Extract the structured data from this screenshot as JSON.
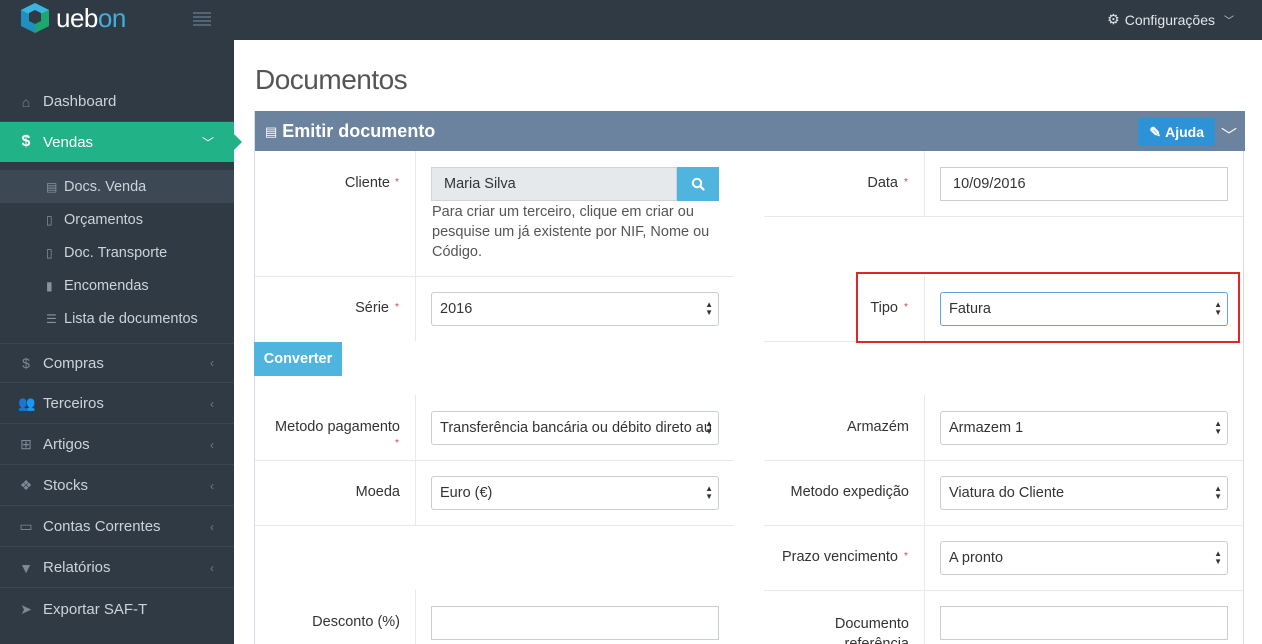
{
  "brand": {
    "name_prefix": "ueb",
    "name_suffix": "on"
  },
  "topbar": {
    "config_label": "Configurações"
  },
  "sidebar": {
    "items": [
      {
        "label": "Dashboard",
        "icon": "home-icon"
      },
      {
        "label": "Vendas",
        "icon": "dollar-icon",
        "active": true
      },
      {
        "label": "Compras",
        "icon": "dollar-icon"
      },
      {
        "label": "Terceiros",
        "icon": "users-icon"
      },
      {
        "label": "Artigos",
        "icon": "sitemap-icon"
      },
      {
        "label": "Stocks",
        "icon": "cubes-icon"
      },
      {
        "label": "Contas Correntes",
        "icon": "credit-card-icon"
      },
      {
        "label": "Relatórios",
        "icon": "filter-icon"
      },
      {
        "label": "Exportar SAF-T",
        "icon": "paper-plane-icon"
      }
    ],
    "submenu": [
      {
        "label": "Docs. Venda",
        "icon": "document-icon"
      },
      {
        "label": "Orçamentos",
        "icon": "file-icon"
      },
      {
        "label": "Doc. Transporte",
        "icon": "file-icon"
      },
      {
        "label": "Encomendas",
        "icon": "file-filled-icon"
      },
      {
        "label": "Lista de documentos",
        "icon": "list-icon"
      }
    ]
  },
  "page": {
    "title": "Documentos"
  },
  "panel": {
    "title": "Emitir documento",
    "help_label": "Ajuda"
  },
  "form": {
    "cliente": {
      "label": "Cliente",
      "value": "Maria Silva",
      "help": [
        "Para criar um terceiro, clique em criar ou",
        "pesquise um já existente por NIF, Nome ou",
        "Código."
      ]
    },
    "data": {
      "label": "Data",
      "value": "10/09/2016"
    },
    "serie": {
      "label": "Série",
      "value": "2016"
    },
    "tipo": {
      "label": "Tipo",
      "value": "Fatura"
    },
    "converter_label": "Converter",
    "metodo_pagamento": {
      "label": "Metodo pagamento",
      "value": "Transferência bancária ou débito direto au"
    },
    "armazem": {
      "label": "Armazém",
      "value": "Armazem 1"
    },
    "moeda": {
      "label": "Moeda",
      "value": "Euro (€)"
    },
    "metodo_expedicao": {
      "label": "Metodo expedição",
      "value": "Viatura do Cliente"
    },
    "prazo_vencimento": {
      "label": "Prazo vencimento",
      "value": "A pronto"
    },
    "desconto": {
      "label": "Desconto (%)",
      "value": ""
    },
    "documento_referencia": {
      "label_line1": "Documento",
      "label_line2": "referência",
      "value": ""
    }
  },
  "colors": {
    "topbar": "#2f3a45",
    "active": "#21b387",
    "panel_header": "#6b839e",
    "accent": "#4fb5df",
    "highlight": "#e02727"
  }
}
